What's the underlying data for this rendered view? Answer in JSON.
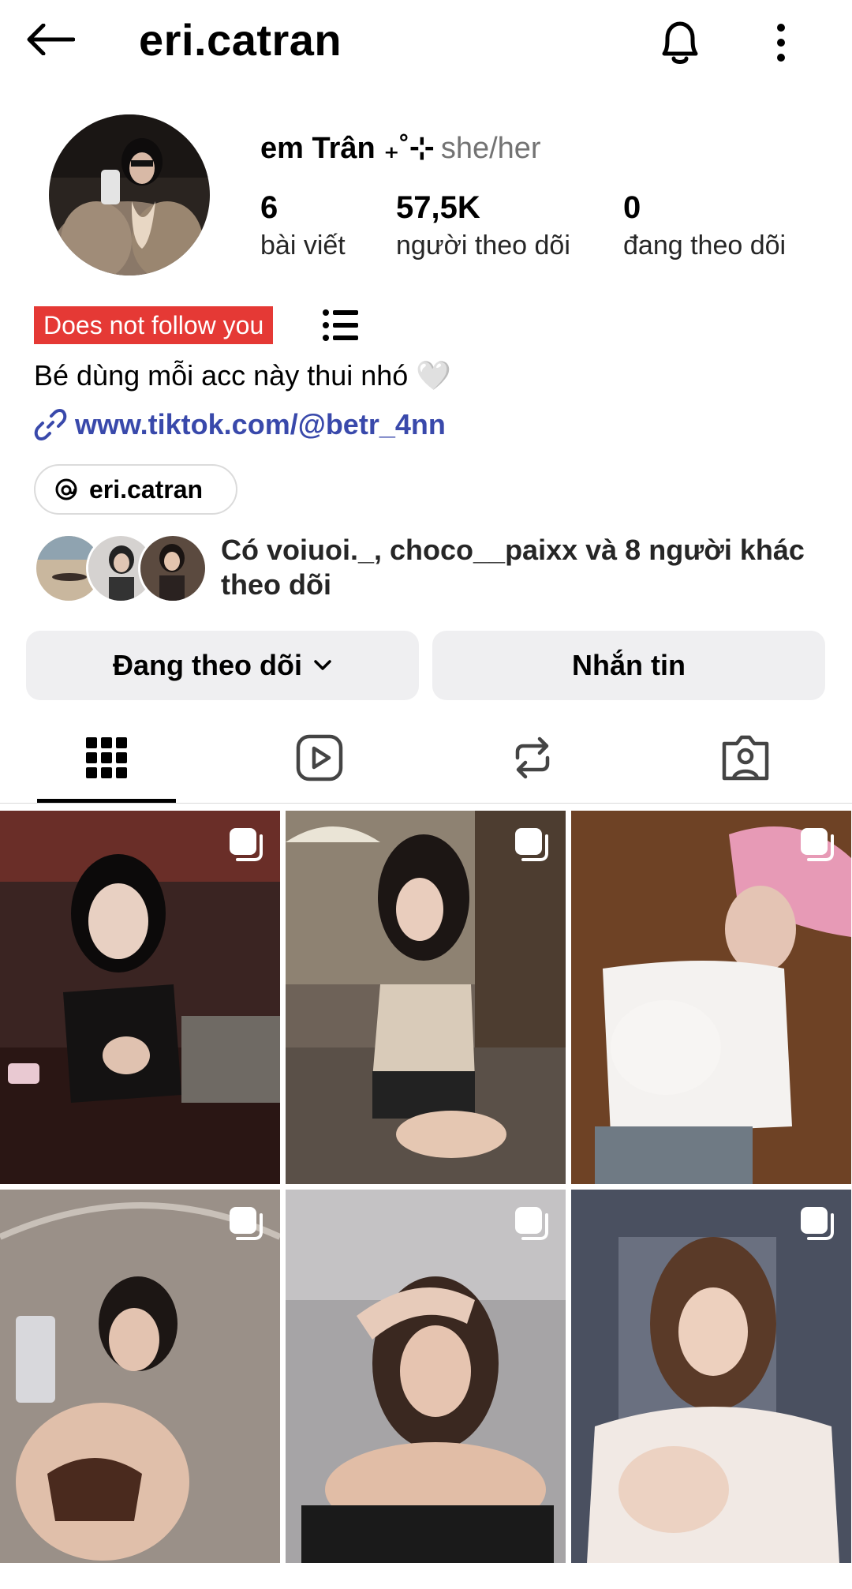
{
  "header": {
    "username": "eri.catran",
    "back_icon": "arrow-left-icon",
    "notifications_icon": "bell-icon",
    "more_icon": "more-vertical-icon"
  },
  "profile": {
    "display_name": "em Trân ₊˚⊹",
    "pronouns": "she/her",
    "stats": {
      "posts_count": "6",
      "posts_label": "bài viết",
      "followers_count": "57,5K",
      "followers_label": "người theo dõi",
      "following_count": "0",
      "following_label": "đang theo dõi"
    },
    "badge": "Does not follow you",
    "bio": "Bé dùng mỗi acc này thui nhó 🤍",
    "link": "www.tiktok.com/@betr_4nn",
    "threads_handle": "eri.catran",
    "mutual_text": "Có voiuoi._, choco__paixx và 8 người khác theo dõi"
  },
  "actions": {
    "following_label": "Đang theo dõi",
    "message_label": "Nhắn tin"
  },
  "tabs": [
    {
      "name": "grid",
      "icon": "grid-icon",
      "active": true
    },
    {
      "name": "reels",
      "icon": "reels-icon",
      "active": false
    },
    {
      "name": "reposts",
      "icon": "repost-icon",
      "active": false
    },
    {
      "name": "tagged",
      "icon": "tagged-icon",
      "active": false
    }
  ],
  "colors": {
    "badge_bg": "#e53935",
    "link": "#3949ab",
    "button_bg": "#efeff1"
  },
  "posts": [
    {
      "type": "carousel"
    },
    {
      "type": "carousel"
    },
    {
      "type": "carousel"
    },
    {
      "type": "carousel"
    },
    {
      "type": "carousel"
    },
    {
      "type": "carousel"
    }
  ]
}
